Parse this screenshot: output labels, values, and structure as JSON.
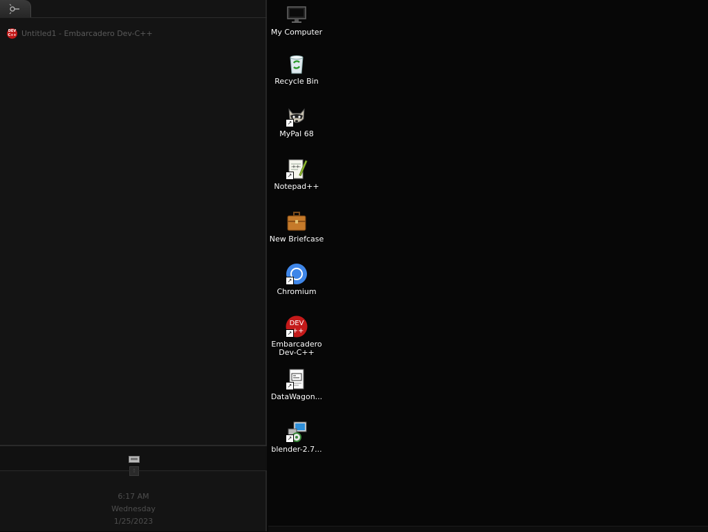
{
  "taskbar": {
    "start_icon": "start-orb-icon",
    "tasks": [
      {
        "title": "Untitled1 - Embarcadero Dev-C++",
        "icon": "devcpp-icon"
      }
    ],
    "tray": {
      "keyboard_icon": "keyboard-icon",
      "expander_label": "+"
    },
    "clock": {
      "time": "6:17 AM",
      "day": "Wednesday",
      "date": "1/25/2023"
    }
  },
  "desktop": {
    "icons": [
      {
        "label": "My Computer",
        "icon": "monitor-icon"
      },
      {
        "label": "Recycle Bin",
        "icon": "recycle-bin-icon"
      },
      {
        "label": "MyPal 68",
        "icon": "raccoon-icon",
        "shortcut": true
      },
      {
        "label": "Notepad++",
        "icon": "notepad-plus-icon",
        "shortcut": true
      },
      {
        "label": "New Briefcase",
        "icon": "briefcase-icon"
      },
      {
        "label": "Chromium",
        "icon": "chromium-icon",
        "shortcut": true
      },
      {
        "label": "Embarcadero Dev-C++",
        "icon": "devcpp-icon",
        "shortcut": true
      },
      {
        "label": "DataWagon...",
        "icon": "datawagon-icon",
        "shortcut": true
      },
      {
        "label": "blender-2.7...",
        "icon": "installer-icon",
        "shortcut": true
      }
    ]
  },
  "devcpp_badge": {
    "top": "DEV",
    "bottom": "C++",
    "big_bottom": "++"
  },
  "shortcut_arrow": "↗",
  "colors": {
    "taskbar_bg": "#141414",
    "desktop_bg": "#070707",
    "accent_red": "#c41a1a"
  }
}
